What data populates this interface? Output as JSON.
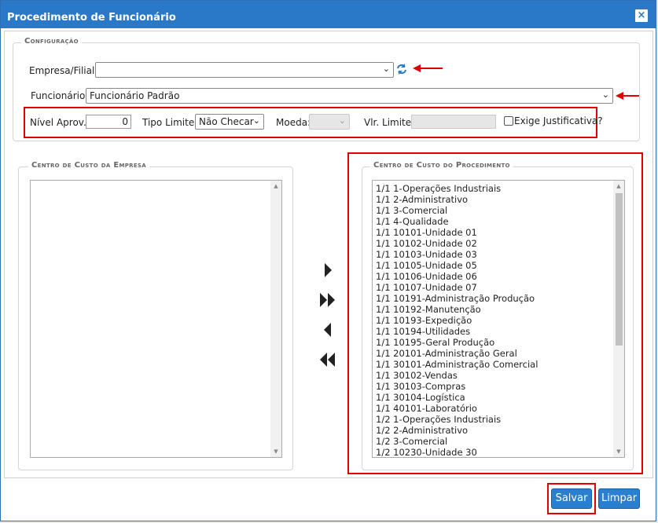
{
  "dialog": {
    "title": "Procedimento de Funcionário",
    "close_label": "×"
  },
  "config": {
    "legend": "Configuração",
    "empresa_label": "Empresa/Filial:",
    "empresa_value": "",
    "funcionario_label": "Funcionário:",
    "funcionario_value": "Funcionário Padrão",
    "nivel_label": "Nível Aprov.:",
    "nivel_value": "0",
    "tipo_limite_label": "Tipo Limite:",
    "tipo_limite_value": "Não Checar",
    "moeda_label": "Moeda:",
    "moeda_value": "",
    "vlr_limite_label": "Vlr. Limite:",
    "vlr_limite_value": "",
    "exige_label": "Exige Justificativa?"
  },
  "left_panel": {
    "legend": "Centro de Custo da Empresa",
    "items": []
  },
  "right_panel": {
    "legend": "Centro de Custo do Procedimento",
    "items": [
      "1/1 1-Operações Industriais",
      "1/1 2-Administrativo",
      "1/1 3-Comercial",
      "1/1 4-Qualidade",
      "1/1 10101-Unidade 01",
      "1/1 10102-Unidade 02",
      "1/1 10103-Unidade 03",
      "1/1 10105-Unidade 05",
      "1/1 10106-Unidade 06",
      "1/1 10107-Unidade 07",
      "1/1 10191-Administração Produção",
      "1/1 10192-Manutenção",
      "1/1 10193-Expedição",
      "1/1 10194-Utilidades",
      "1/1 10195-Geral Produção",
      "1/1 20101-Administração Geral",
      "1/1 30101-Administração Comercial",
      "1/1 30102-Vendas",
      "1/1 30103-Compras",
      "1/1 30104-Logística",
      "1/1 40101-Laboratório",
      "1/2 1-Operações Industriais",
      "1/2 2-Administrativo",
      "1/2 3-Comercial",
      "1/2 10230-Unidade 30"
    ]
  },
  "buttons": {
    "save": "Salvar",
    "clear": "Limpar"
  },
  "icons": {
    "refresh": "refresh-icon",
    "move_right": "move-right-icon",
    "move_all_right": "move-all-right-icon",
    "move_left": "move-left-icon",
    "move_all_left": "move-all-left-icon"
  },
  "colors": {
    "title_bar": "#2a78c8",
    "highlight": "#e00000",
    "button": "#2a7fd0"
  }
}
